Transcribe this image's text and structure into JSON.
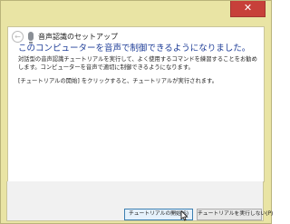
{
  "window": {
    "close_label": "✕"
  },
  "wizard": {
    "back_glyph": "←",
    "title": "音声認識のセットアップ"
  },
  "main": {
    "heading": "このコンピューターを音声で制御できるようになりました。",
    "body": "対話型の音声認識チュートリアルを実行して、よく使用するコマンドを練習することをお勧めします。コンピューターを音声で適切に制御できるようになります。",
    "instruction": "[チュートリアルの開始] をクリックすると、チュートリアルが実行されます。"
  },
  "footer": {
    "start_button": "チュートリアルの開始(S)",
    "skip_button": "チュートリアルを実行しない(P)"
  },
  "colors": {
    "window_frame": "#e9e4a4",
    "heading": "#1f3e98",
    "close_button": "#c7403a",
    "default_button_border": "#3c7fb1"
  },
  "icons": {
    "back": "back-arrow-icon",
    "app": "microphone-icon",
    "cursor": "mouse-pointer-icon"
  }
}
